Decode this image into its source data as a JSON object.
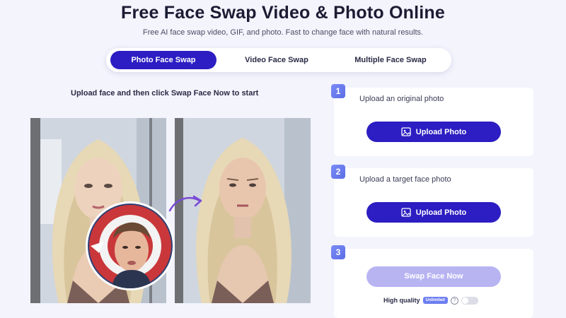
{
  "header": {
    "title": "Free Face Swap Video & Photo Online",
    "subtitle": "Free AI face swap video, GIF, and photo. Fast to change face with natural results."
  },
  "tabs": [
    {
      "label": "Photo Face Swap",
      "active": true
    },
    {
      "label": "Video Face Swap",
      "active": false
    },
    {
      "label": "Multiple Face Swap",
      "active": false
    }
  ],
  "demo": {
    "instruction": "Upload face and then click Swap Face Now to start"
  },
  "steps": [
    {
      "number": "1",
      "label": "Upload an original photo",
      "button": "Upload Photo",
      "icon": "image-upload-icon"
    },
    {
      "number": "2",
      "label": "Upload a target face photo",
      "button": "Upload Photo",
      "icon": "image-upload-icon"
    },
    {
      "number": "3",
      "button": "Swap Face Now",
      "high_quality_label": "High quality",
      "high_quality_badge": "Unlimited",
      "toggle_on": false
    }
  ],
  "colors": {
    "accent": "#2c1ec2",
    "accent_disabled": "#b8b4f2",
    "background": "#f3f4fc",
    "step_badge": "#6c7df0"
  }
}
